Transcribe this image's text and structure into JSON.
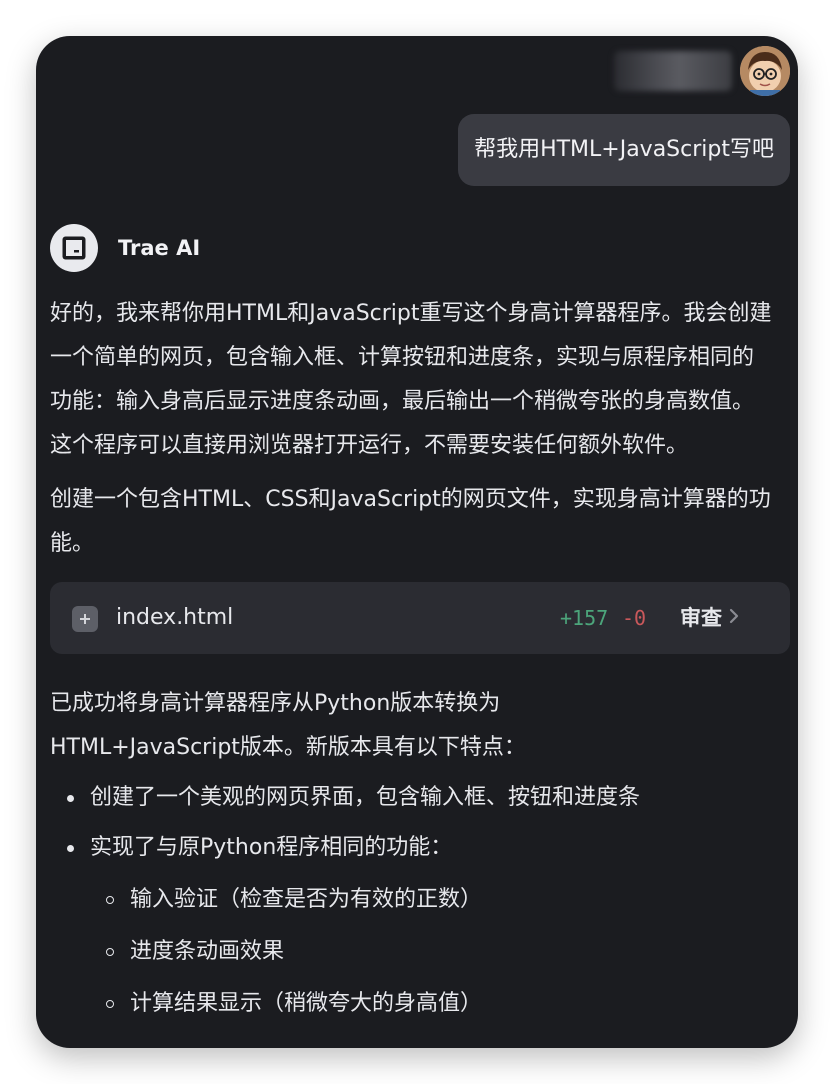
{
  "user": {
    "message": "帮我用HTML+JavaScript写吧",
    "avatar_icon": "user-avatar-icon"
  },
  "assistant": {
    "name": "Trae AI",
    "logo_icon": "trae-logo-icon",
    "intro_paragraph": "好的，我来帮你用HTML和JavaScript重写这个身高计算器程序。我会创建一个简单的网页，包含输入框、计算按钮和进度条，实现与原程序相同的功能：输入身高后显示进度条动画，最后输出一个稍微夸张的身高数值。这个程序可以直接用浏览器打开运行，不需要安装任何额外软件。",
    "plan_paragraph": "创建一个包含HTML、CSS和JavaScript的网页文件，实现身高计算器的功能。",
    "file_change": {
      "icon": "plus-icon",
      "filename": "index.html",
      "additions": "+157",
      "deletions": "-0",
      "review_label": "审查",
      "review_icon": "chevron-right-icon"
    },
    "summary_paragraph": "已成功将身高计算器程序从Python版本转换为HTML+JavaScript版本。新版本具有以下特点：",
    "features": [
      "创建了一个美观的网页界面，包含输入框、按钮和进度条",
      "实现了与原Python程序相同的功能："
    ],
    "sub_features": [
      "输入验证（检查是否为有效的正数）",
      "进度条动画效果",
      "计算结果显示（稍微夸大的身高值）"
    ]
  },
  "colors": {
    "panel_background": "#1b1c20",
    "user_bubble": "#3a3b42",
    "card_background": "#2b2c32",
    "additions": "#4ca57b",
    "deletions": "#c9585b"
  }
}
